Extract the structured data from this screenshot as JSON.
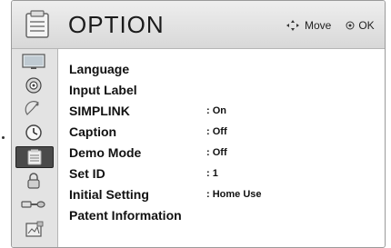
{
  "header": {
    "title": "OPTION",
    "icon": "option-menu-icon",
    "hints": {
      "move_label": "Move",
      "move_icon": "dpad-icon",
      "ok_label": "OK",
      "ok_icon": "ok-circle-icon"
    }
  },
  "sidebar": {
    "items": [
      {
        "icon": "picture-monitor-icon"
      },
      {
        "icon": "speaker-audio-icon"
      },
      {
        "icon": "satellite-setup-icon"
      },
      {
        "icon": "clock-time-icon"
      },
      {
        "icon": "option-menu-icon",
        "selected": true
      },
      {
        "icon": "lock-icon"
      },
      {
        "icon": "input-plug-icon"
      },
      {
        "icon": "usb-media-icon"
      }
    ]
  },
  "menu": {
    "items": [
      {
        "label": "Language",
        "value": ""
      },
      {
        "label": "Input Label",
        "value": ""
      },
      {
        "label": "SIMPLINK",
        "value": ": On"
      },
      {
        "label": "Caption",
        "value": ": Off"
      },
      {
        "label": "Demo Mode",
        "value": ": Off"
      },
      {
        "label": "Set ID",
        "value": ": 1"
      },
      {
        "label": "Initial Setting",
        "value": ": Home Use"
      },
      {
        "label": "Patent Information",
        "value": ""
      }
    ]
  },
  "colors": {
    "header_bg": "#e2e2e2",
    "sidebar_bg": "#e3e3e3",
    "selected_bg": "#4a4a4a"
  }
}
